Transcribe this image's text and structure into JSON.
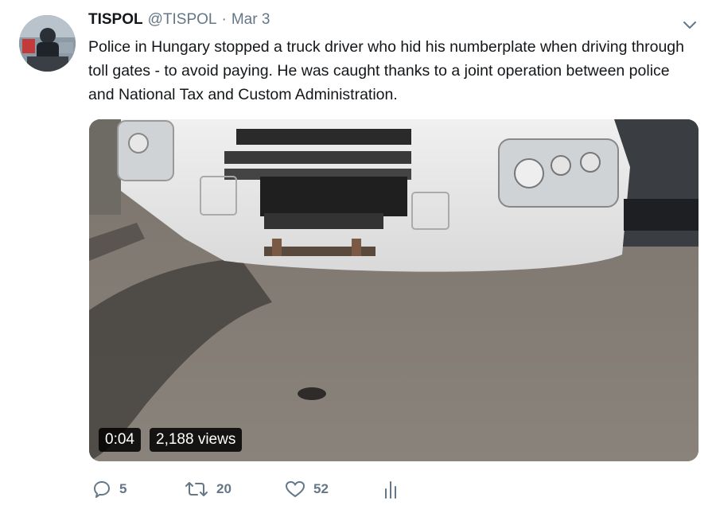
{
  "tweet": {
    "display_name": "TISPOL",
    "handle": "@TISPOL",
    "separator": "·",
    "date": "Mar 3",
    "text": "Police in Hungary stopped a truck driver who hid his numberplate when driving through toll gates - to avoid paying. He was caught thanks to a joint operation between police and National Tax and Custom Administration."
  },
  "media": {
    "time": "0:04",
    "views": "2,188 views"
  },
  "actions": {
    "replies": "5",
    "retweets": "20",
    "likes": "52"
  },
  "icons": {
    "reply": "reply-icon",
    "retweet": "retweet-icon",
    "like": "heart-icon",
    "analytics": "analytics-icon",
    "menu": "chevron-down-icon"
  },
  "colors": {
    "text": "#14171a",
    "secondary": "#657786"
  }
}
